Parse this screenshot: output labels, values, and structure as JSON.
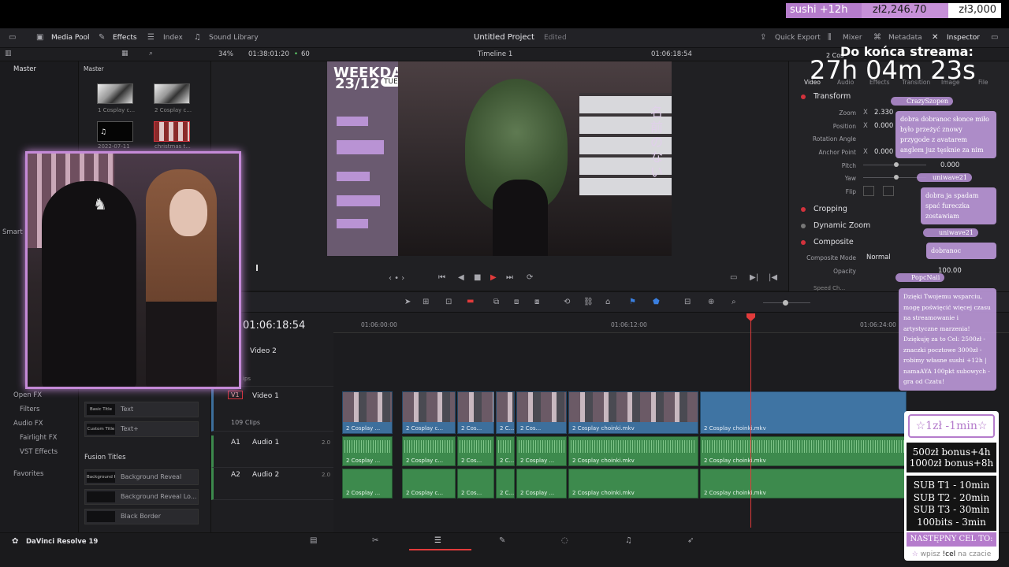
{
  "stream_goal": {
    "text": "sushi +12h",
    "current": "zł2,246.70",
    "target": "zł3,000"
  },
  "toolbar": {
    "media_pool": "Media Pool",
    "effects": "Effects",
    "index": "Index",
    "sound_library": "Sound Library",
    "project_title": "Untitled Project",
    "project_status": "Edited",
    "quick_export": "Quick Export",
    "mixer": "Mixer",
    "metadata": "Metadata",
    "inspector": "Inspector"
  },
  "row2": {
    "zoom": "34%",
    "timecode_src": "01:38:01:20",
    "fps": "60",
    "timeline_name": "Timeline 1",
    "timecode_rec": "01:06:18:54"
  },
  "media_pool": {
    "bin": "Master",
    "master_label": "Master",
    "clips": [
      {
        "caption": "1 Cosplay c..."
      },
      {
        "caption": "2 Cosplay c..."
      },
      {
        "caption": "2022-07-11"
      },
      {
        "caption": "christmas t..."
      }
    ]
  },
  "effects_sidebar": {
    "smart_bins": "Smart B",
    "open_fx": "Open FX",
    "filters": "Filters",
    "audio_fx": "Audio FX",
    "fairlight_fx": "Fairlight FX",
    "vst_effects": "VST Effects",
    "favorites": "Favorites"
  },
  "titles": [
    {
      "thumb": "Basic Title",
      "name": "Text"
    },
    {
      "thumb": "Custom Title",
      "name": "Text+"
    }
  ],
  "fusion_titles_header": "Fusion Titles",
  "fusion_titles": [
    {
      "thumb": "Background Reveal",
      "name": "Background Reveal"
    },
    {
      "thumb": "",
      "name": "Background Reveal Lo..."
    },
    {
      "thumb": "",
      "name": "Black Border"
    }
  ],
  "inspector": {
    "tabs": [
      "Video",
      "Audio",
      "Effects",
      "Transition",
      "Image",
      "File"
    ],
    "clip_name": "2 Cos",
    "sections": {
      "transform": "Transform",
      "cropping": "Cropping",
      "dynamic_zoom": "Dynamic Zoom",
      "composite": "Composite",
      "speed": "Speed Ch..."
    },
    "params": {
      "zoom_label": "Zoom",
      "zoom_axis": "X",
      "zoom_value": "2.330",
      "position_label": "Position",
      "position_axis": "X",
      "position_value": "0.000",
      "rotation_label": "Rotation Angle",
      "anchor_label": "Anchor Point",
      "anchor_axis": "X",
      "anchor_value": "0.000",
      "pitch_label": "Pitch",
      "pitch_value": "0.000",
      "yaw_label": "Yaw",
      "flip_label": "Flip",
      "composite_mode_label": "Composite Mode",
      "composite_mode_value": "Normal",
      "opacity_label": "Opacity",
      "opacity_value": "100.00"
    }
  },
  "timeline": {
    "timecode": "01:06:18:54",
    "ruler": [
      "01:06:00:00",
      "01:06:12:00",
      "01:06:24:00"
    ],
    "tracks": {
      "v2": {
        "name": "Video 2",
        "note": "ips"
      },
      "v1": {
        "id": "V1",
        "name": "Video 1",
        "clips": "109 Clips"
      },
      "a1": {
        "id": "A1",
        "name": "Audio 1",
        "ch": "2.0"
      },
      "a2": {
        "id": "A2",
        "name": "Audio 2",
        "ch": "2.0"
      }
    },
    "video_clips": [
      "2 Cosplay ...",
      "2 Cosplay c...",
      "2 Cos...",
      "2 C...",
      "2 Cos...",
      "2 Cosplay choinki.mkv",
      "2 Cosplay choinki.mkv"
    ],
    "audio1_clips": [
      "2 Cosplay ...",
      "2 Cosplay c...",
      "2 Cos...",
      "2 C...",
      "2 Cosplay ...",
      "2 Cosplay choinki.mkv",
      "2 Cosplay choinki.mkv"
    ],
    "audio2_clips": [
      "2 Cosplay ...",
      "2 Cosplay c...",
      "2 Cos...",
      "2 C...",
      "2 Cosplay ...",
      "2 Cosplay choinki.mkv",
      "2 Cosplay choinki.mkv"
    ]
  },
  "app_name": "DaVinci Resolve 19",
  "overlay": {
    "countdown_label": "Do końca streama:",
    "countdown_time": "27h 04m 23s",
    "preview_date": "23/12",
    "preview_day": "TUE",
    "preview_brand": "WEEKDAY",
    "preview_side_text": "名前のない",
    "chat": [
      {
        "user": "CrazySzopen",
        "message": "dobra dobranoc słonce miło było przeżyć znowy przygode z avatarem anglem juz tęsknie za nim"
      },
      {
        "user": "uniwave21",
        "message": "dobra ja spadam spać fureczka zostawiam"
      },
      {
        "user": "uniwave21",
        "message": "dobranoc"
      },
      {
        "user": "PopcNaii",
        "message": "Dzięki Twojemu wsparciu, mogę poświęcić więcej czasu na streamowanie i artystyczne marzenia! Dziękuję za to Cel: 2500zł - znaczki pocztowe 3000zł - robimy własne sushi +12h | namaAYA 100pkt subowych - gra od Czatu!"
      }
    ],
    "sub_panel": {
      "rate": "☆1zł -1min☆",
      "bonus": [
        "500zł bonus+4h",
        "1000zł bonus+8h"
      ],
      "subs": [
        "SUB T1 - 10min",
        "SUB T2 - 20min",
        "SUB T3 - 30min",
        "100bits - 3min"
      ],
      "next_goal": "NASTĘPNY CEL TO:",
      "command_prefix": "wpisz",
      "command": "!cel",
      "command_suffix": "na czacie"
    }
  },
  "colors": {
    "accent_purple": "#b57ccc",
    "playhead": "#e23b3b",
    "video_clip": "#3d6f9c",
    "audio_clip": "#3d8a4d",
    "panel_bg": "#1e1e21"
  }
}
